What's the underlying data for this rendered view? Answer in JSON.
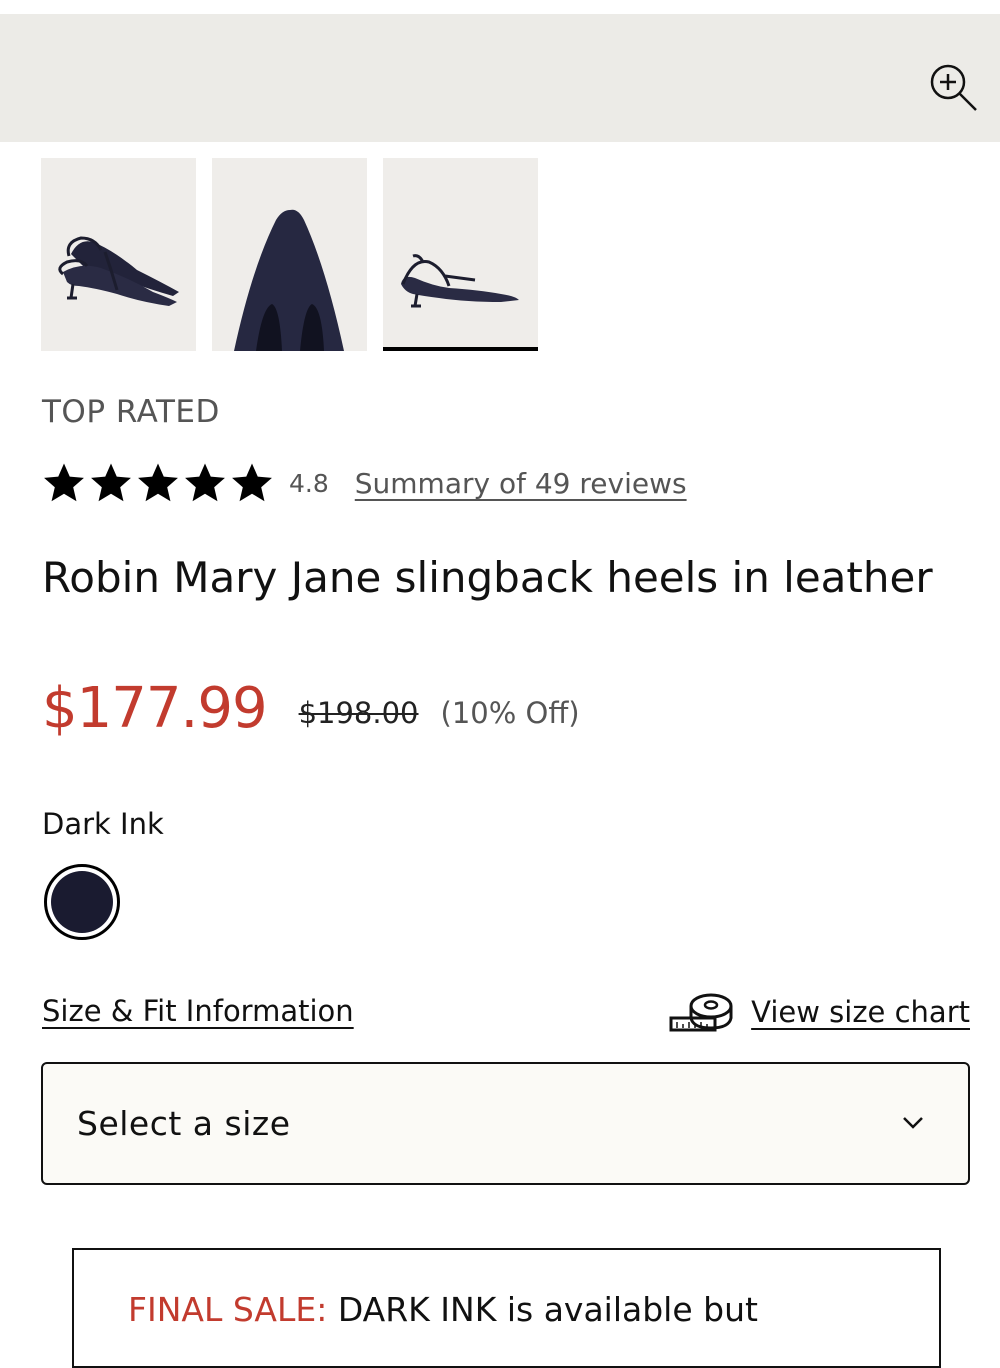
{
  "gallery": {
    "zoom_icon": "zoom-in-icon",
    "thumbnails": [
      {
        "alt": "side view"
      },
      {
        "alt": "toe close-up"
      },
      {
        "alt": "profile view",
        "active": true
      }
    ]
  },
  "product": {
    "badge": "TOP RATED",
    "rating": {
      "stars": 5,
      "value": "4.8",
      "reviews_label": "Summary of 49 reviews"
    },
    "title": "Robin Mary Jane slingback heels in leather",
    "price": {
      "sale": "$177.99",
      "original": "$198.00",
      "discount": "(10% Off)"
    },
    "color": {
      "name": "Dark Ink",
      "swatch_color": "#1a1b30"
    },
    "size": {
      "fit_info_label": "Size & Fit Information",
      "chart_label": "View size chart",
      "chart_icon": "measuring-tape-icon",
      "select_placeholder": "Select a size"
    },
    "notice": {
      "label": "FINAL SALE:",
      "message": " DARK INK is available but"
    }
  },
  "colors": {
    "sale_red": "#c23b2e",
    "hero_bg": "#ecebe7"
  }
}
